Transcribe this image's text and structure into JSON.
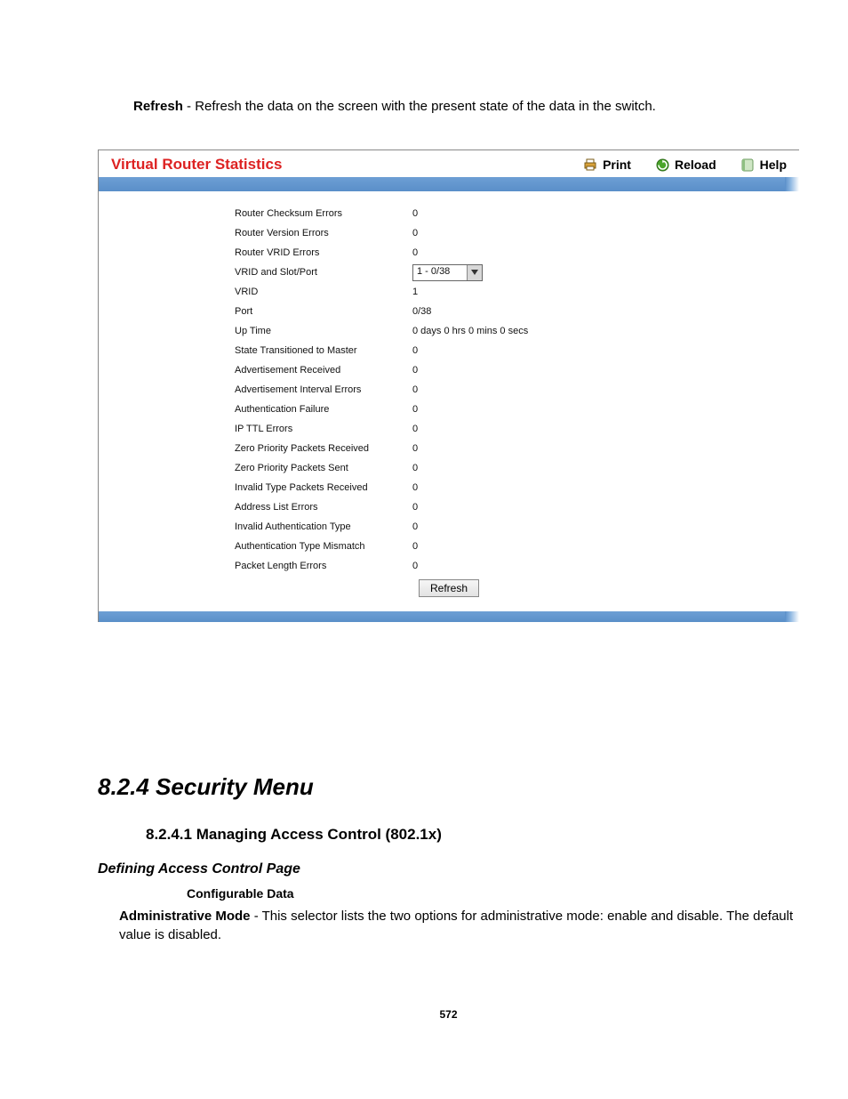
{
  "intro": {
    "refresh_label": "Refresh",
    "refresh_desc": " - Refresh the data on the screen with the present state of the data in the switch."
  },
  "panel": {
    "title": "Virtual Router Statistics",
    "toolbar": {
      "print": "Print",
      "reload": "Reload",
      "help": "Help"
    },
    "select_value": "1 - 0/38",
    "rows": [
      {
        "label": "Router Checksum Errors",
        "value": "0",
        "type": "text"
      },
      {
        "label": "Router Version Errors",
        "value": "0",
        "type": "text"
      },
      {
        "label": "Router VRID Errors",
        "value": "0",
        "type": "text"
      },
      {
        "label": "VRID and Slot/Port",
        "value": "",
        "type": "select"
      },
      {
        "label": "VRID",
        "value": "1",
        "type": "text"
      },
      {
        "label": "Port",
        "value": "0/38",
        "type": "text"
      },
      {
        "label": "Up Time",
        "value": "0 days 0 hrs 0 mins 0 secs",
        "type": "text"
      },
      {
        "label": "State Transitioned to Master",
        "value": "0",
        "type": "text"
      },
      {
        "label": "Advertisement Received",
        "value": "0",
        "type": "text"
      },
      {
        "label": "Advertisement Interval Errors",
        "value": "0",
        "type": "text"
      },
      {
        "label": "Authentication Failure",
        "value": "0",
        "type": "text"
      },
      {
        "label": "IP TTL Errors",
        "value": "0",
        "type": "text"
      },
      {
        "label": "Zero Priority Packets Received",
        "value": "0",
        "type": "text"
      },
      {
        "label": "Zero Priority Packets Sent",
        "value": "0",
        "type": "text"
      },
      {
        "label": "Invalid Type Packets Received",
        "value": "0",
        "type": "text"
      },
      {
        "label": "Address List Errors",
        "value": "0",
        "type": "text"
      },
      {
        "label": "Invalid Authentication Type",
        "value": "0",
        "type": "text"
      },
      {
        "label": "Authentication Type Mismatch",
        "value": "0",
        "type": "text"
      },
      {
        "label": "Packet Length Errors",
        "value": "0",
        "type": "text"
      }
    ],
    "refresh_btn": "Refresh"
  },
  "doc": {
    "section": "8.2.4 Security Menu",
    "sub": "8.2.4.1 Managing Access Control (802.1x)",
    "sub2": "Defining Access Control Page",
    "sub3": "Configurable Data",
    "admin_label": "Administrative Mode",
    "admin_desc": " - This selector lists the two options for administrative mode: enable and disable. The default value is disabled.",
    "page_num": "572"
  }
}
